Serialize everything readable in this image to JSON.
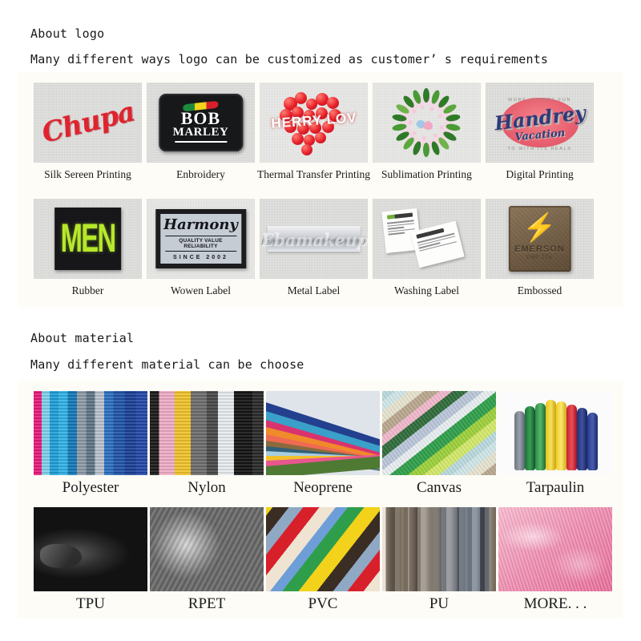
{
  "sections": [
    {
      "heading": "About logo",
      "subheading": "Many different ways logo can be customized as customer’ s requirements",
      "items": [
        {
          "label": "Silk Sereen Printing",
          "art": "chupa-script-logo",
          "art_text": "Chupa"
        },
        {
          "label": "Enbroidery",
          "art": "bob-marley-patch",
          "art_text": "BOB",
          "art_text2": "MARLEY"
        },
        {
          "label": "Thermal Transfer Printing",
          "art": "cherry-heart-print",
          "art_text": "HERRY LOV"
        },
        {
          "label": "Sublimation Printing",
          "art": "floral-wreath-birds",
          "art_text": ""
        },
        {
          "label": "Digital Printing",
          "art": "vintage-badge-logo",
          "art_text": "Handrey",
          "art_text2": "Vacation",
          "art_text3": "WORK IS PURE FUN",
          "art_text4": "TO WITH ITS REALS"
        }
      ]
    },
    {
      "heading": "About material",
      "subheading": "Many different material can be choose",
      "items": [
        {
          "label": "Rubber",
          "art": "rubber-patch-men",
          "art_text": "MEN"
        },
        {
          "label": "Wowen Label",
          "art": "woven-label-harmony",
          "art_text": "Harmony",
          "art_text2": "QUALITY VALUE RELIABILITY",
          "art_text3": "SINCE 2002"
        },
        {
          "label": "Metal Label",
          "art": "metal-script-label",
          "art_text": "Ebamakeup"
        },
        {
          "label": "Washing Label",
          "art": "care-tags",
          "art_text": ""
        },
        {
          "label": "Embossed",
          "art": "embossed-leather-patch",
          "art_text": "EMERSON",
          "art_text2": "EMP-27A"
        }
      ]
    }
  ],
  "logo_rows": [
    [
      0,
      1,
      2,
      3,
      4
    ],
    [
      5,
      6,
      7,
      8,
      9
    ]
  ],
  "logo_items": [
    {
      "label": "Silk Sereen Printing"
    },
    {
      "label": "Enbroidery"
    },
    {
      "label": "Thermal Transfer Printing"
    },
    {
      "label": "Sublimation Printing"
    },
    {
      "label": "Digital Printing"
    },
    {
      "label": "Rubber"
    },
    {
      "label": "Wowen Label"
    },
    {
      "label": "Metal Label"
    },
    {
      "label": "Washing Label"
    },
    {
      "label": "Embossed"
    }
  ],
  "material_items": [
    {
      "label": "Polyester",
      "swatch": "polyester-vertical-stripes"
    },
    {
      "label": "Nylon",
      "swatch": "nylon-vertical-stripes"
    },
    {
      "label": "Neoprene",
      "swatch": "neoprene-fanned-sheets"
    },
    {
      "label": "Canvas",
      "swatch": "canvas-diagonal-stripes"
    },
    {
      "label": "Tarpaulin",
      "swatch": "tarpaulin-rolled-sheets"
    },
    {
      "label": "TPU",
      "swatch": "tpu-glossy-black"
    },
    {
      "label": "RPET",
      "swatch": "rpet-gray-draped"
    },
    {
      "label": "PVC",
      "swatch": "pvc-diagonal-stripes"
    },
    {
      "label": "PU",
      "swatch": "pu-leather-rolls"
    },
    {
      "label": "MORE. . .",
      "swatch": "pink-plush-fur"
    }
  ],
  "artwork_text": {
    "chupa": "Chupa",
    "bob": "BOB",
    "marley": "MARLEY",
    "herry": "HERRY LOV",
    "handrey": "Handrey",
    "vacation": "Vacation",
    "badge_arc_top": "WORK IS PURE FUN",
    "badge_arc_bottom": "TO WITH ITS REALS",
    "men": "MEN",
    "harmony": "Harmony",
    "qvr": "QUALITY VALUE RELIABILITY",
    "since": "SINCE 2002",
    "ebamakeup": "Ebamakeup",
    "emerson": "EMERSON",
    "emerson_sub": "EMP-27A"
  },
  "colors": {
    "panel_background": "#fdfcf6",
    "page_background": "#ffffff",
    "text": "#1a1a1a",
    "chupa_red": "#e0232e",
    "rasta_green": "#1e8a3c",
    "rasta_yellow": "#f2d21a",
    "rasta_red": "#d8202a",
    "cherry_red": "#e8202a",
    "men_green": "#b6e82a",
    "leather_brown": "#6f5b43",
    "badge_pink": "#e8606f",
    "badge_navy": "#2e3b7a",
    "fur_pink": "#ef8fb2"
  }
}
